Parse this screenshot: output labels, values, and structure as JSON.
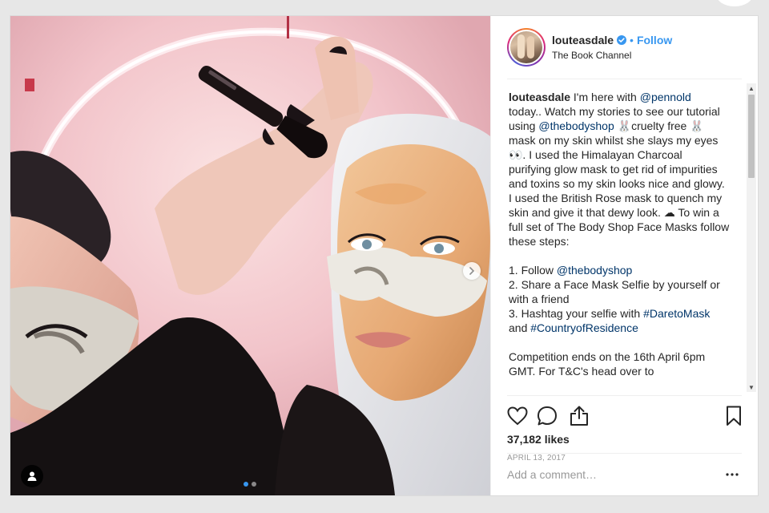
{
  "post": {
    "author": {
      "username": "louteasdale",
      "verified": true,
      "follow_label": "Follow",
      "separator": "•",
      "location": "The Book Channel"
    },
    "caption": {
      "username": "louteasdale",
      "lines": [
        [
          {
            "t": " I'm here with "
          },
          {
            "t": "@pennold",
            "m": true
          }
        ],
        [
          {
            "t": "today.. Watch my stories to see our tutorial"
          }
        ],
        [
          {
            "t": "using "
          },
          {
            "t": "@thebodyshop",
            "m": true
          },
          {
            "t": " 🐰cruelty free 🐰"
          }
        ],
        [
          {
            "t": "mask on my skin whilst she slays my eyes"
          }
        ],
        [
          {
            "t": "👀. I used the Himalayan Charcoal"
          }
        ],
        [
          {
            "t": "purifying glow mask to get rid of impurities"
          }
        ],
        [
          {
            "t": "and toxins so my skin looks nice and glowy."
          }
        ],
        [
          {
            "t": "I used the British Rose mask to quench my"
          }
        ],
        [
          {
            "t": "skin and give it that dewy look. ☁ To win a"
          }
        ],
        [
          {
            "t": "full set of The Body Shop Face Masks follow"
          }
        ],
        [
          {
            "t": "these steps:"
          }
        ],
        [],
        [
          {
            "t": "1. Follow "
          },
          {
            "t": "@thebodyshop",
            "m": true
          }
        ],
        [
          {
            "t": "2. Share a Face Mask Selfie by yourself or"
          }
        ],
        [
          {
            "t": "with a friend"
          }
        ],
        [
          {
            "t": "3. Hashtag your selfie with "
          },
          {
            "t": "#DaretoMask",
            "m": true
          }
        ],
        [
          {
            "t": "and "
          },
          {
            "t": "#CountryofResidence",
            "m": true
          }
        ],
        [],
        [
          {
            "t": "Competition ends on the 16th April 6pm"
          }
        ],
        [
          {
            "t": "GMT. For T&C's head over to"
          }
        ]
      ]
    },
    "actions": {
      "like_icon": "heart-outline-icon",
      "comment_icon": "speech-bubble-icon",
      "share_icon": "share-upload-icon",
      "save_icon": "bookmark-icon"
    },
    "likes": "37,182 likes",
    "date": "APRIL 13, 2017",
    "comment": {
      "placeholder": "Add a comment…",
      "value": "",
      "more_icon": "ellipsis-icon"
    },
    "media": {
      "carousel_count": 2,
      "active_index": 0,
      "next_icon": "chevron-right-icon",
      "tag_icon": "user-tag-icon"
    }
  },
  "colors": {
    "link": "#3897f0",
    "mention": "#003569",
    "carousel_active": "#3897f0"
  }
}
